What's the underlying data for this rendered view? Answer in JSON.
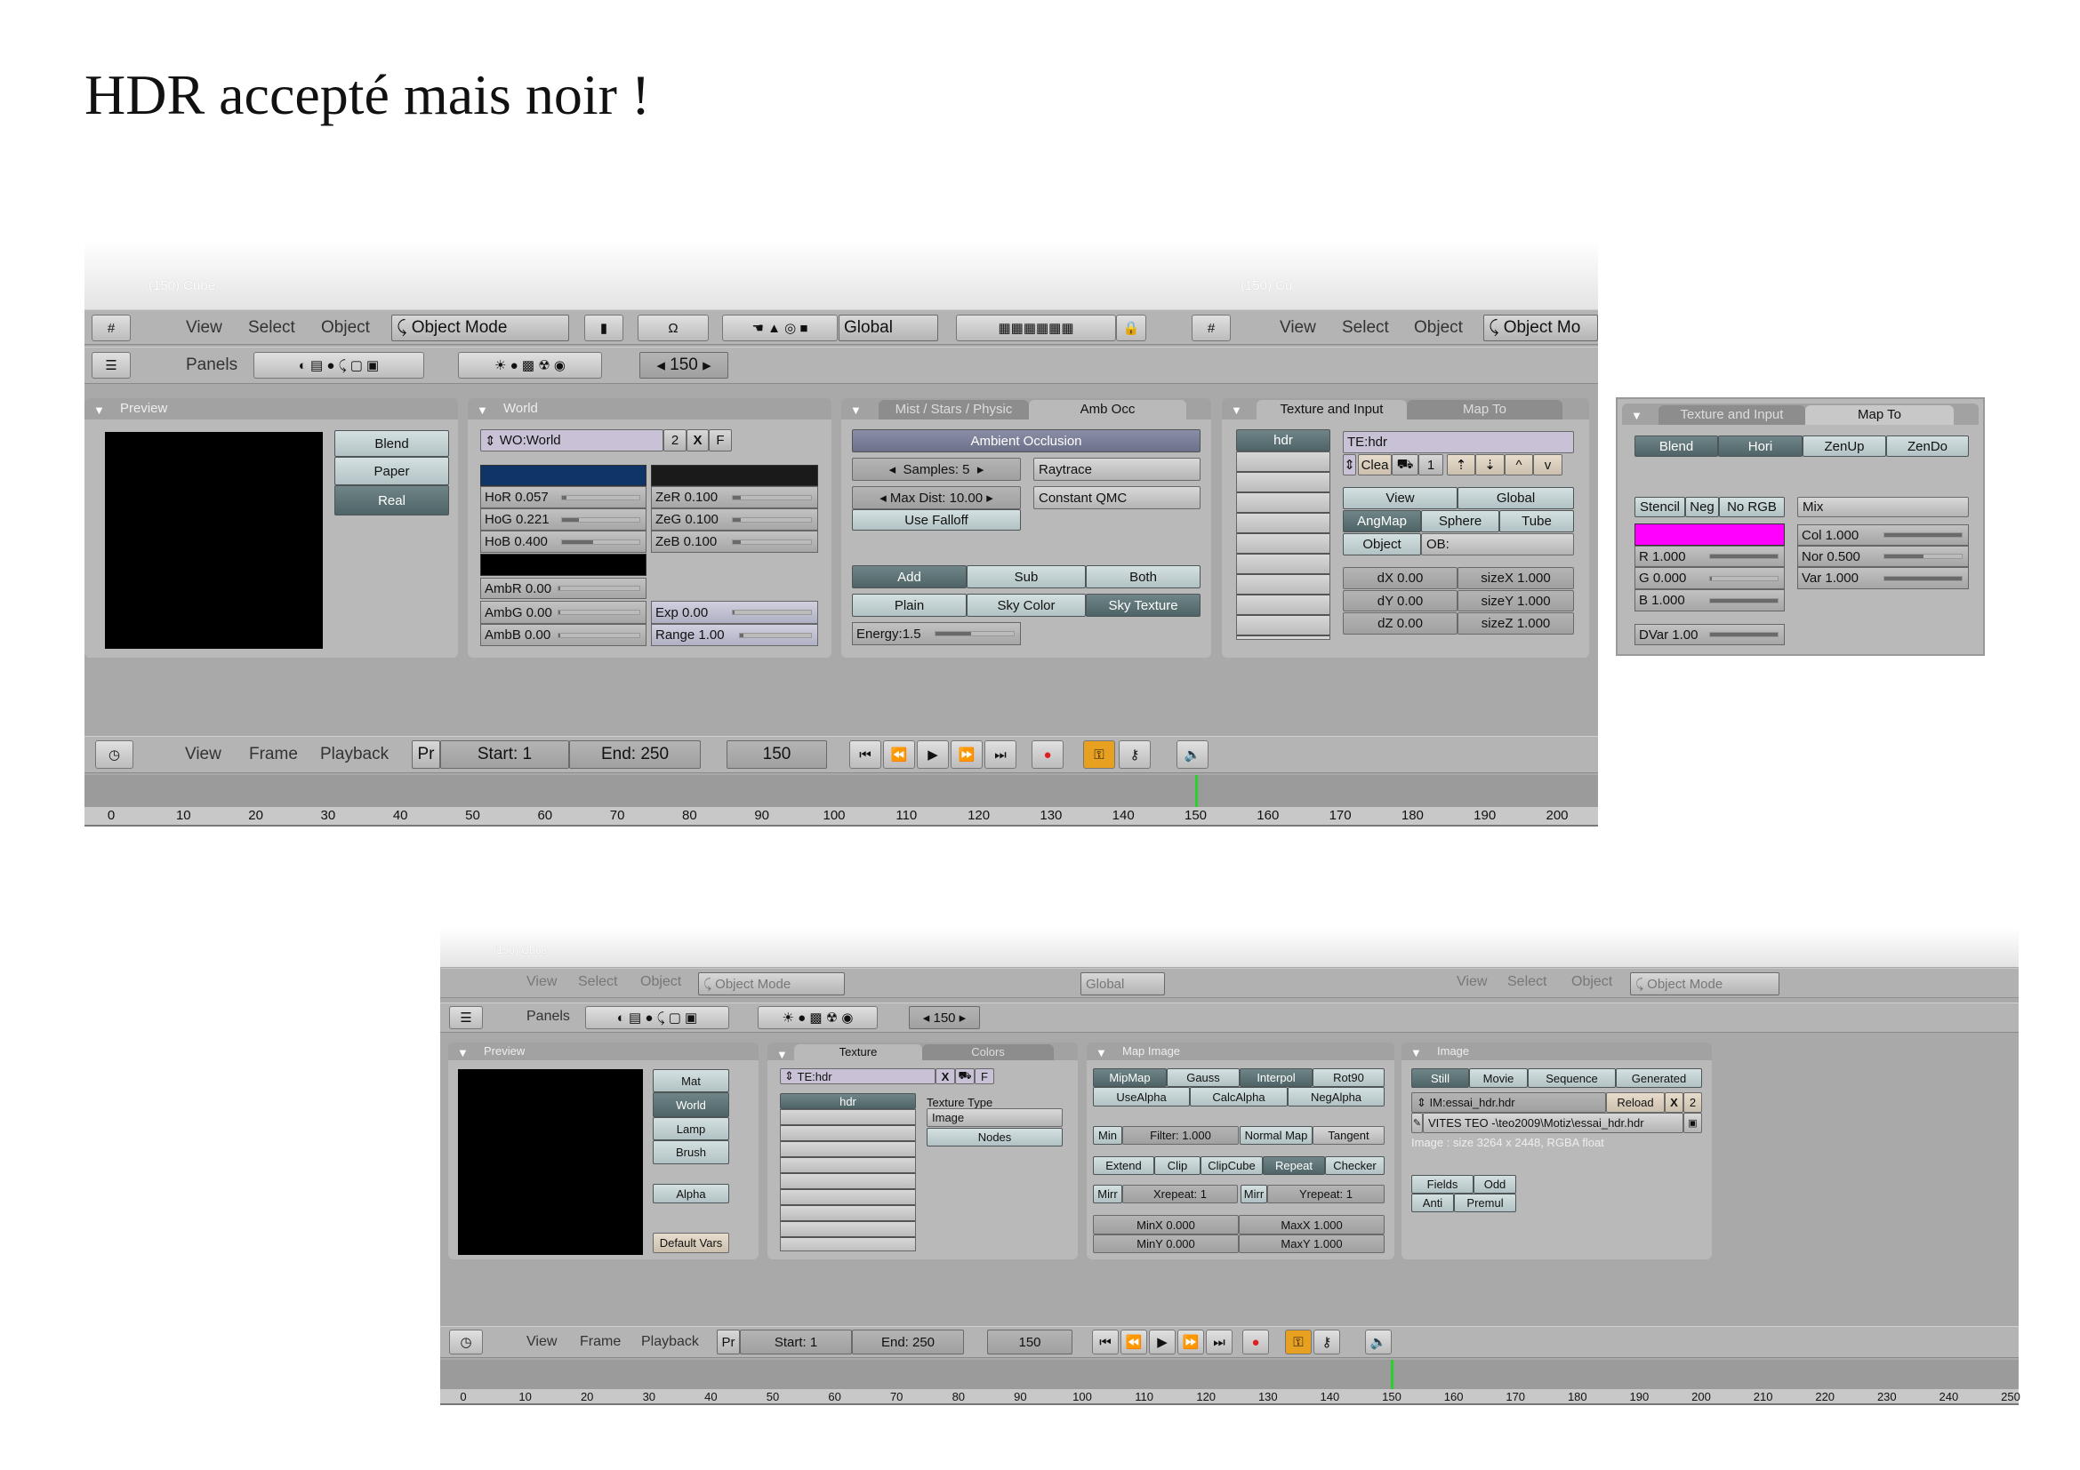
{
  "title": "HDR accepté mais noir !",
  "top": {
    "viewport_label": "(150) Cube",
    "viewport_label2": "(150) Cu",
    "header": {
      "menus": [
        "View",
        "Select",
        "Object"
      ],
      "mode": "Object Mode",
      "orientation": "Global",
      "menus2": [
        "View",
        "Select",
        "Object"
      ],
      "mode2": "Object Mo"
    },
    "buttons_header": {
      "panels": "Panels",
      "frame": "150"
    },
    "preview": {
      "title": "Preview",
      "buttons": [
        "Blend",
        "Paper",
        "Real"
      ],
      "active": "Real"
    },
    "world": {
      "title": "World",
      "name": "WO:World",
      "users": "2",
      "x": "X",
      "f": "F",
      "horizon_color": "#0f3566",
      "zenith_color": "#1a1a1a",
      "ambient_color": "#000000",
      "sliders": [
        {
          "label": "HoR 0.057",
          "level": 0.057
        },
        {
          "label": "HoG 0.221",
          "level": 0.221
        },
        {
          "label": "HoB 0.400",
          "level": 0.4
        },
        {
          "label": "ZeR 0.100",
          "level": 0.1
        },
        {
          "label": "ZeG 0.100",
          "level": 0.1
        },
        {
          "label": "ZeB 0.100",
          "level": 0.1
        },
        {
          "label": "AmbR 0.00",
          "level": 0
        },
        {
          "label": "AmbG 0.00",
          "level": 0
        },
        {
          "label": "AmbB 0.00",
          "level": 0
        },
        {
          "label": "Exp 0.00",
          "level": 0
        },
        {
          "label": "Range 1.00",
          "level": 0.05
        }
      ]
    },
    "ao": {
      "tabs": [
        "Mist / Stars / Physic",
        "Amb Occ"
      ],
      "active_tab": "Amb Occ",
      "header": "Ambient Occlusion",
      "samples": "Samples: 5",
      "method": "Raytrace",
      "max_dist": "Max Dist: 10.00",
      "sampling": "Constant QMC",
      "falloff": "Use Falloff",
      "blend": [
        "Add",
        "Sub",
        "Both"
      ],
      "blend_active": "Add",
      "color": [
        "Plain",
        "Sky Color",
        "Sky Texture"
      ],
      "color_active": "Sky Texture",
      "energy": {
        "label": "Energy:1.5",
        "level": 0.45
      }
    },
    "texinput": {
      "tabs": [
        "Texture and Input",
        "Map To"
      ],
      "active_tab": "Texture and Input",
      "slots": [
        "hdr"
      ],
      "tex_name": "TE:hdr",
      "clear": "Clea",
      "users": "1",
      "up": "^",
      "down": "v",
      "coords": [
        "View",
        "Global"
      ],
      "coords_active": "Global",
      "proj": [
        "AngMap",
        "Sphere",
        "Tube"
      ],
      "proj_active": "AngMap",
      "object": "Object",
      "ob": "OB:",
      "offsets": [
        "dX 0.00",
        "dY 0.00",
        "dZ 0.00"
      ],
      "sizes": [
        "sizeX 1.000",
        "sizeY 1.000",
        "sizeZ 1.000"
      ]
    },
    "timeline": {
      "menus": [
        "View",
        "Frame",
        "Playback"
      ],
      "pr": "Pr",
      "start": "Start: 1",
      "end": "End: 250",
      "frame": "150",
      "ticks": [
        "0",
        "10",
        "20",
        "30",
        "40",
        "50",
        "60",
        "70",
        "80",
        "90",
        "100",
        "110",
        "120",
        "130",
        "140",
        "150",
        "160",
        "170",
        "180",
        "190",
        "200"
      ],
      "current": 150
    }
  },
  "mapto": {
    "tabs": [
      "Texture and Input",
      "Map To"
    ],
    "active_tab": "Map To",
    "targets": [
      "Blend",
      "Hori",
      "ZenUp",
      "ZenDo"
    ],
    "targets_active": [
      "Blend",
      "Hori"
    ],
    "flags": [
      "Stencil",
      "Neg",
      "No RGB"
    ],
    "color": "#ff00ff",
    "rgb": [
      {
        "label": "R 1.000",
        "level": 1
      },
      {
        "label": "G 0.000",
        "level": 0
      },
      {
        "label": "B 1.000",
        "level": 1
      }
    ],
    "dvar": {
      "label": "DVar 1.00",
      "level": 1
    },
    "blend_mode": "Mix",
    "factors": [
      {
        "label": "Col  1.000",
        "level": 1
      },
      {
        "label": "Nor  0.500",
        "level": 0.5
      },
      {
        "label": "Var  1.000",
        "level": 1
      }
    ]
  },
  "bottom": {
    "viewport_label": "(150) Cube",
    "header": {
      "menus": [
        "View",
        "Select",
        "Object"
      ],
      "mode": "Object Mode",
      "orientation": "Global",
      "menus2": [
        "View",
        "Select",
        "Object"
      ],
      "mode2": "Object Mode"
    },
    "buttons_header": {
      "panels": "Panels",
      "frame": "150"
    },
    "preview": {
      "title": "Preview",
      "buttons": [
        "Mat",
        "World",
        "Lamp",
        "Brush"
      ],
      "active": "World",
      "alpha": "Alpha",
      "defaults": "Default Vars"
    },
    "texture": {
      "tabs": [
        "Texture",
        "Colors"
      ],
      "active_tab": "Texture",
      "name": "TE:hdr",
      "x": "X",
      "f": "F",
      "slots": [
        "hdr"
      ],
      "type_label": "Texture Type",
      "type": "Image",
      "nodes": "Nodes"
    },
    "mapimage": {
      "title": "Map Image",
      "row1": [
        "MipMap",
        "Gauss",
        "Interpol",
        "Rot90"
      ],
      "row1_active": [
        "MipMap",
        "Interpol"
      ],
      "row2": [
        "UseAlpha",
        "CalcAlpha",
        "NegAlpha"
      ],
      "min": "Min",
      "filter": "Filter: 1.000",
      "normal_map": "Normal Map",
      "space": "Tangent",
      "ext": [
        "Extend",
        "Clip",
        "ClipCube",
        "Repeat",
        "Checker"
      ],
      "ext_active": "Repeat",
      "mirr": "Mirr",
      "xrepeat": "Xrepeat: 1",
      "yrepeat": "Yrepeat: 1",
      "minx": "MinX 0.000",
      "maxx": "MaxX 1.000",
      "miny": "MinY 0.000",
      "maxy": "MaxY 1.000"
    },
    "image": {
      "title": "Image",
      "sources": [
        "Still",
        "Movie",
        "Sequence",
        "Generated"
      ],
      "source_active": "Still",
      "name": "IM:essai_hdr.hdr",
      "reload": "Reload",
      "x": "X",
      "users": "2",
      "path": "VITES TEO -\\teo2009\\Motiz\\essai_hdr.hdr",
      "info": "Image : size 3264 x 2448, RGBA float",
      "fields": "Fields",
      "odd": "Odd",
      "anti": "Anti",
      "premul": "Premul"
    },
    "timeline": {
      "menus": [
        "View",
        "Frame",
        "Playback"
      ],
      "pr": "Pr",
      "start": "Start: 1",
      "end": "End: 250",
      "frame": "150",
      "ticks": [
        "0",
        "10",
        "20",
        "30",
        "40",
        "50",
        "60",
        "70",
        "80",
        "90",
        "100",
        "110",
        "120",
        "130",
        "140",
        "150",
        "160",
        "170",
        "180",
        "190",
        "200",
        "210",
        "220",
        "230",
        "240",
        "250"
      ],
      "current": 150
    }
  }
}
